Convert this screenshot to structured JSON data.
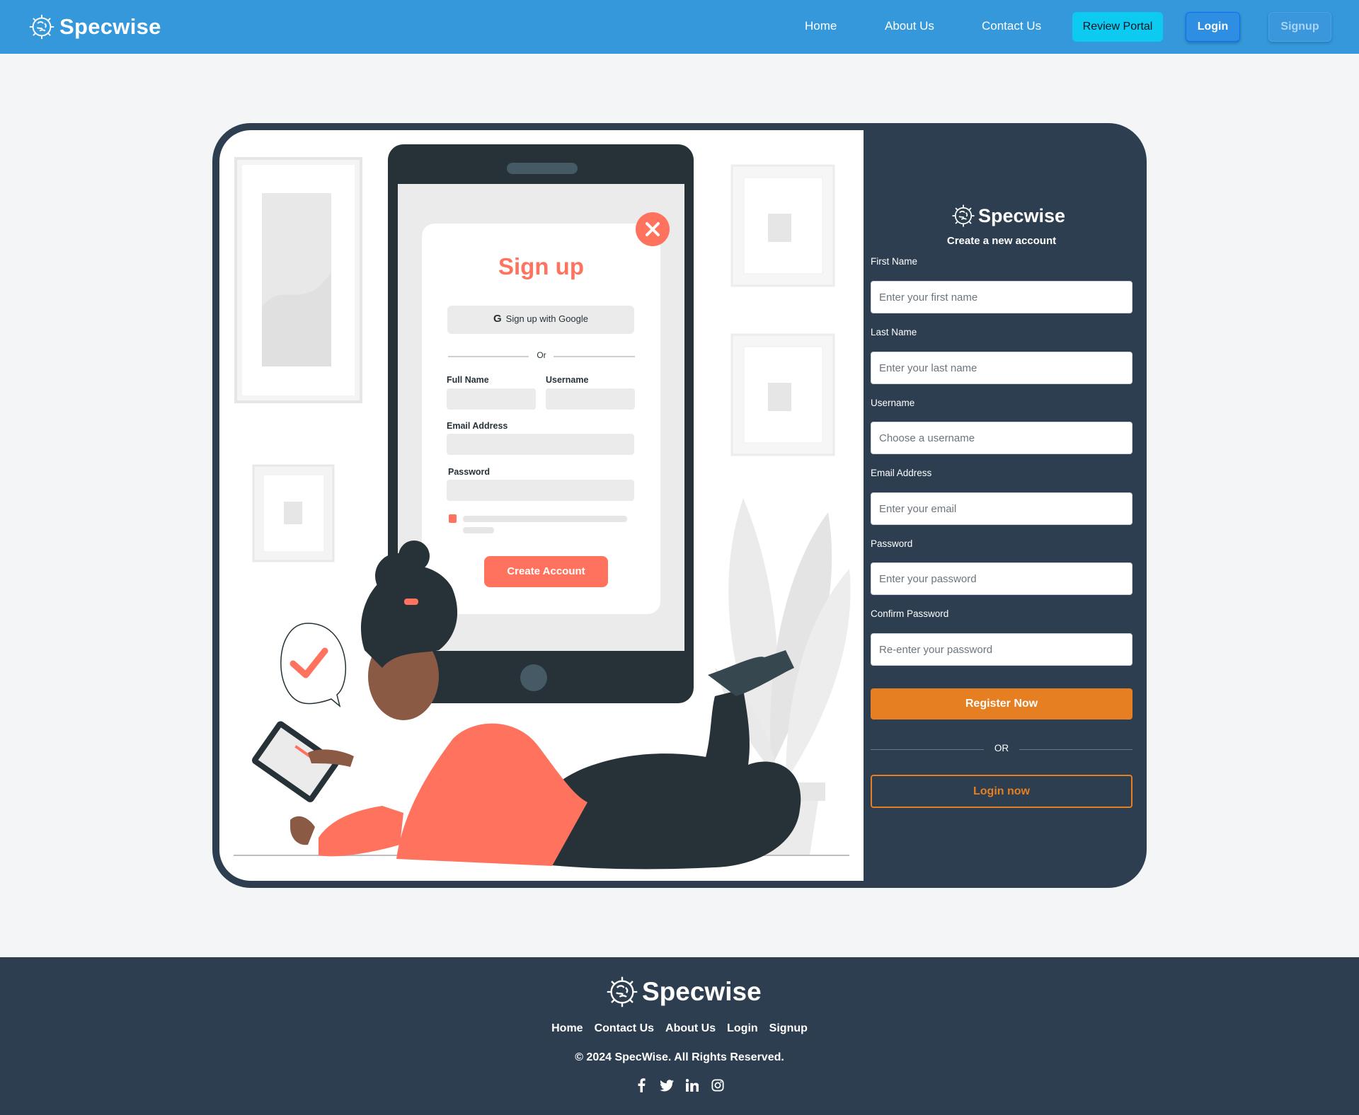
{
  "brand": {
    "name": "Specwise"
  },
  "nav": {
    "links": [
      "Home",
      "About Us",
      "Contact Us"
    ],
    "review_portal": "Review Portal",
    "login": "Login",
    "signup": "Signup"
  },
  "illustration": {
    "title": "Sign up",
    "google_button": "Sign up with Google",
    "or": "Or",
    "full_name": "Full Name",
    "username": "Username",
    "email": "Email Address",
    "password": "Password",
    "create_account": "Create Account"
  },
  "form": {
    "subtitle": "Create a new account",
    "fields": [
      {
        "label": "First Name",
        "placeholder": "Enter your first name"
      },
      {
        "label": "Last Name",
        "placeholder": "Enter your last name"
      },
      {
        "label": "Username",
        "placeholder": "Choose a username"
      },
      {
        "label": "Email Address",
        "placeholder": "Enter your email"
      },
      {
        "label": "Password",
        "placeholder": "Enter your password"
      },
      {
        "label": "Confirm Password",
        "placeholder": "Re-enter your password"
      }
    ],
    "register_button": "Register Now",
    "or": "OR",
    "login_button": "Login now"
  },
  "footer": {
    "links": [
      "Home",
      "Contact Us",
      "About Us",
      "Login",
      "Signup"
    ],
    "copyright": "© 2024 SpecWise. All Rights Reserved.",
    "socials": [
      "facebook-icon",
      "twitter-icon",
      "linkedin-icon",
      "instagram-icon"
    ]
  },
  "colors": {
    "navbar": "#3498db",
    "dark": "#2c3e50",
    "accent": "#e67e22",
    "cyan": "#0dcaf0",
    "illustration_accent": "#ff725e"
  }
}
